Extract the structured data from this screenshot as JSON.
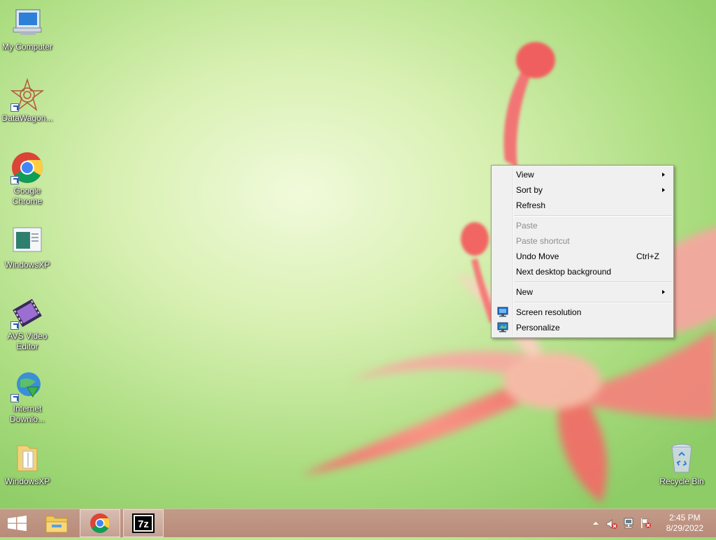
{
  "desktop": {
    "icons": [
      {
        "label": "My Computer"
      },
      {
        "label": "DataWagon..."
      },
      {
        "label": "Google Chrome"
      },
      {
        "label": "WindowsXP"
      },
      {
        "label": "AVS Video Editor"
      },
      {
        "label": "Internet Downlo..."
      },
      {
        "label": "WindowsXP"
      },
      {
        "label": "Recycle Bin"
      }
    ]
  },
  "context_menu": {
    "items": [
      {
        "label": "View",
        "submenu": true
      },
      {
        "label": "Sort by",
        "submenu": true
      },
      {
        "label": "Refresh"
      },
      {
        "label": "Paste",
        "disabled": true
      },
      {
        "label": "Paste shortcut",
        "disabled": true
      },
      {
        "label": "Undo Move",
        "shortcut": "Ctrl+Z"
      },
      {
        "label": "Next desktop background"
      },
      {
        "label": "New",
        "submenu": true
      },
      {
        "label": "Screen resolution",
        "icon": "monitor-icon"
      },
      {
        "label": "Personalize",
        "icon": "personalize-icon"
      }
    ]
  },
  "taskbar": {
    "start_icon": "windows-logo-icon",
    "pinned": [
      "file-explorer-icon",
      "chrome-icon",
      "7zip-icon"
    ],
    "pinned_7z_text": "7z",
    "tray": {
      "icons": [
        "show-hidden-icons",
        "volume-muted-icon",
        "network-icon",
        "action-center-icon"
      ],
      "time": "2:45 PM",
      "date": "8/29/2022"
    }
  },
  "colors": {
    "wallpaper_green": "#b7e28f",
    "flower_pink": "#f46a6a",
    "taskbar": "#bd9180",
    "menu_bg": "#f0f0f0"
  }
}
